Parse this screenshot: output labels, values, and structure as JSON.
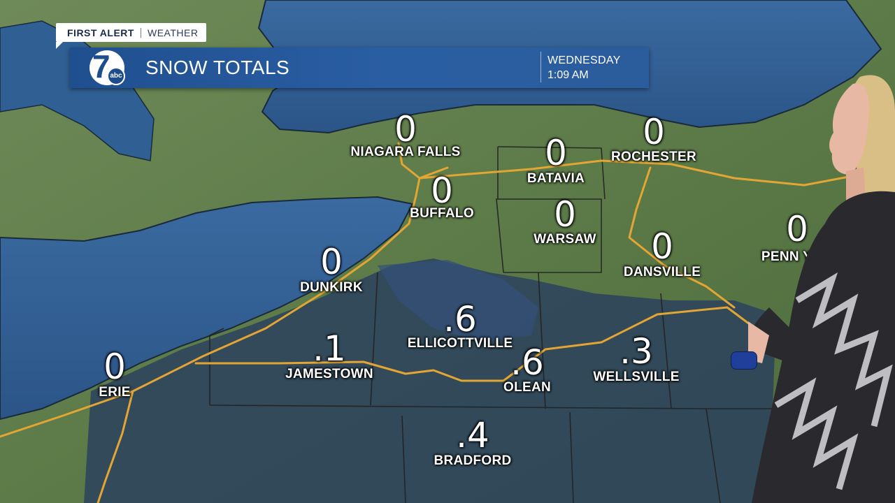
{
  "header": {
    "tag_primary": "FIRST ALERT",
    "tag_secondary": "WEATHER",
    "station_logo": "7abc",
    "title": "SNOW TOTALS",
    "day": "WEDNESDAY",
    "time": "1:09 AM"
  },
  "colors": {
    "lake": "#2f5f93",
    "land": "#5f7f4c",
    "snow_shading": "#2a3f5e",
    "highway": "#e3a533",
    "banner": "#2a5ea3"
  },
  "locations": [
    {
      "name": "NIAGARA FALLS",
      "value": "0"
    },
    {
      "name": "BATAVIA",
      "value": "0"
    },
    {
      "name": "ROCHESTER",
      "value": "0"
    },
    {
      "name": "BUFFALO",
      "value": "0"
    },
    {
      "name": "WARSAW",
      "value": "0"
    },
    {
      "name": "DANSVILLE",
      "value": "0"
    },
    {
      "name": "PENN Y",
      "value": "0"
    },
    {
      "name": "DUNKIRK",
      "value": "0"
    },
    {
      "name": "ELLICOTTVILLE",
      "value": ".6"
    },
    {
      "name": "JAMESTOWN",
      "value": ".1"
    },
    {
      "name": "ERIE",
      "value": "0"
    },
    {
      "name": "OLEAN",
      "value": ".6"
    },
    {
      "name": "WELLSVILLE",
      "value": ".3"
    },
    {
      "name": "BRADFORD",
      "value": ".4"
    }
  ]
}
